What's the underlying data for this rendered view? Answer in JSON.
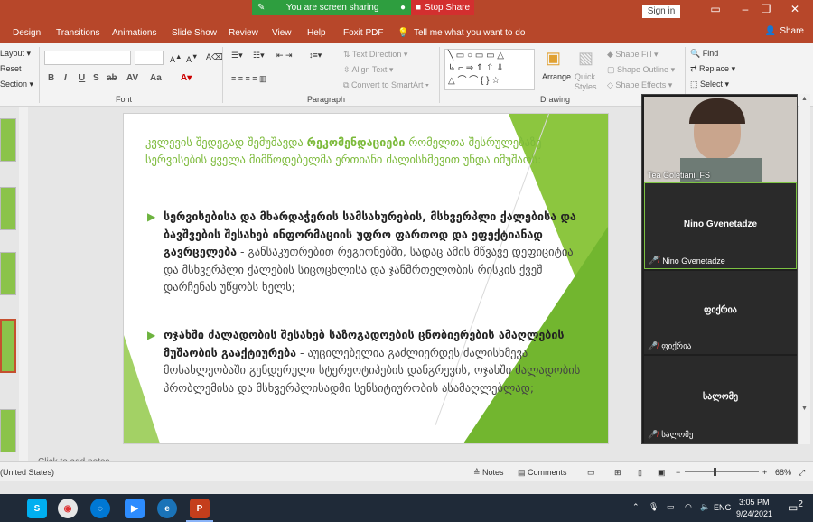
{
  "titlebar": {
    "sharing_banner": "You are screen sharing",
    "stop_share": "Stop Share",
    "sign_in": "Sign in"
  },
  "tabs": [
    "Design",
    "Transitions",
    "Animations",
    "Slide Show",
    "Review",
    "View",
    "Help",
    "Foxit PDF"
  ],
  "tell_me": "Tell me what you want to do",
  "share": "Share",
  "ribbon": {
    "slides_items": [
      "Layout",
      "Reset",
      "Section"
    ],
    "font_group": "Font",
    "paragraph_group": "Paragraph",
    "drawing_group": "Drawing",
    "text_direction": "Text Direction",
    "align_text": "Align Text",
    "convert_smartart": "Convert to SmartArt",
    "arrange": "Arrange",
    "quick_styles": "Quick Styles",
    "shape_fill": "Shape Fill",
    "shape_outline": "Shape Outline",
    "shape_effects": "Shape Effects",
    "find": "Find",
    "replace": "Replace",
    "select": "Select",
    "format_buttons": [
      "B",
      "I",
      "U",
      "S",
      "ab",
      "AV",
      "Aa"
    ]
  },
  "slide": {
    "intro_plain_1": "კვლევის შედეგად შემუშავდა ",
    "intro_bold": "რეკომენდაციები",
    "intro_plain_2": " რომელთა შესრულებაზე სერვისების ყველა მიმწოდებელმა ერთიანი ძალისხმევით უნდა იმუშაოს:",
    "bullet1_bold": "სერვისებისა და მხარდაჭერის სამსახურების, მსხვერპლი ქალებისა და ბავშვების შესახებ ინფორმაციის უფრო ფართოდ და ეფექტიანად გავრცელება",
    "bullet1_plain": " - განსაკუთრებით რეგიონებში, სადაც ამის მწვავე დეფიციტია და მსხვერპლი ქალების სიცოცხლისა და ჯანმრთელობის რისკის ქვეშ დარჩენას უწყობს ხელს;",
    "bullet2_bold": "ოჯახში ძალადობის შესახებ საზოგადოების ცნობიერების ამაღლების მუშაობის გააქტიურება",
    "bullet2_plain": " - აუცილებელია გაძლიერდეს ძალისხმევა მოსახლეობაში გენდერული სტერეოტიპების დანგრევის, ოჯახში ძალადობის პრობლემისა და მსხვერპლისადმი სენსიტიურობის ასამაღლებლად;",
    "notes_hint": "Click to add notes"
  },
  "video": {
    "tile1_label": "Tea Goletiani_FS",
    "tile2_name": "Nino Gvenetadze",
    "tile2_label": "Nino Gvenetadze",
    "tile3_name": "ფიქრია",
    "tile3_label": "ფიქრია",
    "tile4_name": "სალომე",
    "tile4_label": "სალომე"
  },
  "statusbar": {
    "language": "(United States)",
    "notes": "Notes",
    "comments": "Comments",
    "zoom": "68%"
  },
  "taskbar": {
    "time": "3:05 PM",
    "date": "9/24/2021",
    "lang": "ENG",
    "notif_count": "2"
  },
  "colors": {
    "accent": "#b7472a",
    "slide_green": "#8cc63f",
    "share_green": "#2e9e3f",
    "stop_red": "#d32f2f"
  }
}
